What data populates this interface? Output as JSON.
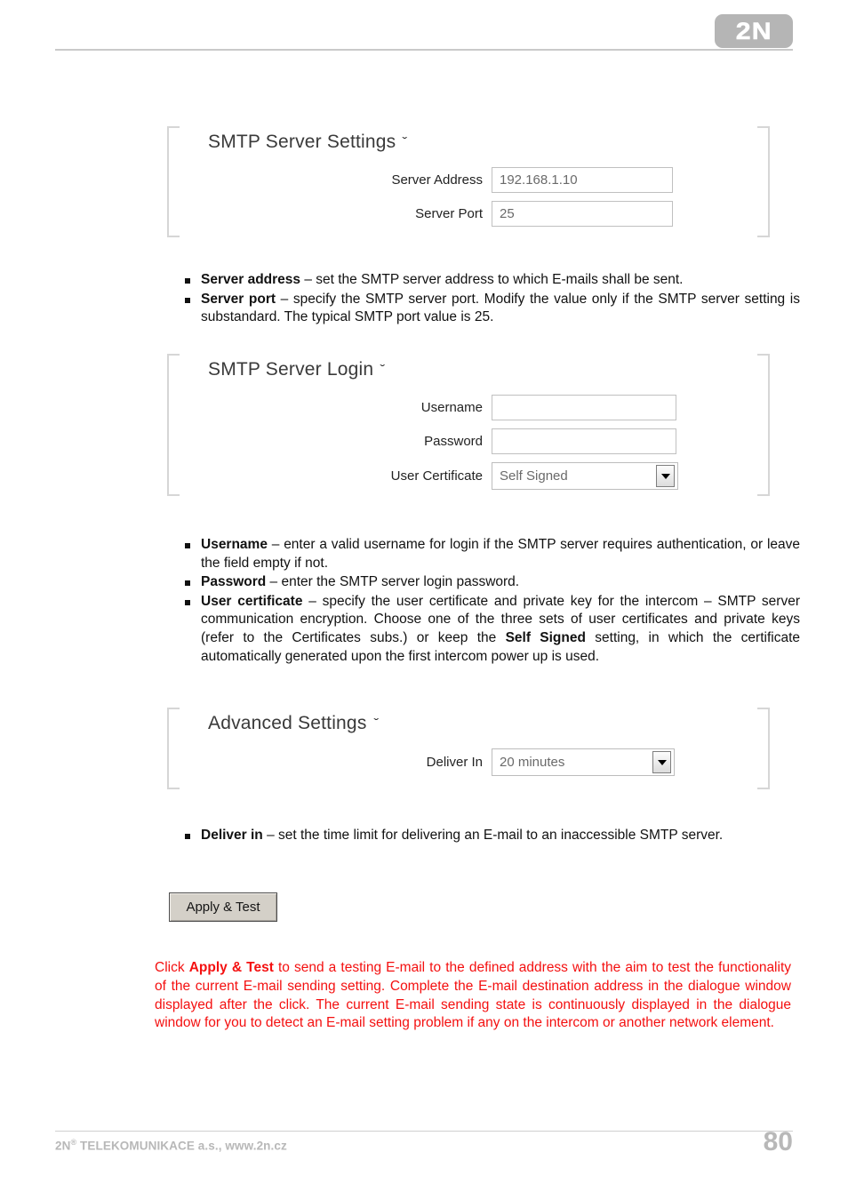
{
  "header": {
    "logo_text": "2N",
    "logo_name": "2n-logo"
  },
  "panels": {
    "smtp_server_settings": {
      "title": "SMTP Server Settings",
      "chevron": "ˇ",
      "fields": [
        {
          "label": "Server Address",
          "value": "192.168.1.10"
        },
        {
          "label": "Server Port",
          "value": "25"
        }
      ]
    },
    "smtp_server_login": {
      "title": "SMTP Server Login",
      "chevron": "ˇ",
      "fields": [
        {
          "label": "Username",
          "value": ""
        },
        {
          "label": "Password",
          "value": ""
        }
      ],
      "select": {
        "label": "User Certificate",
        "value": "Self Signed"
      }
    },
    "advanced_settings": {
      "title": "Advanced Settings",
      "chevron": "ˇ",
      "select": {
        "label": "Deliver In",
        "value": "20 minutes"
      }
    }
  },
  "bullets_group_1": {
    "items": [
      {
        "term": "Server address",
        "text": " – set the SMTP server address to which E-mails shall be sent."
      },
      {
        "term": "Server port",
        "text": " – specify the SMTP server port. Modify the value only if the SMTP server setting is substandard. The typical SMTP port value is 25."
      }
    ]
  },
  "bullets_group_2": {
    "items": [
      {
        "term": "Username",
        "text": " – enter a valid username for login if the SMTP server requires authentication, or leave the field empty if not."
      },
      {
        "term": "Password",
        "text": " – enter the SMTP server login password."
      },
      {
        "term": "User certificate",
        "text_part_1": " – specify the user certificate and private key for the intercom – SMTP server communication encryption. Choose one of the three sets of user certificates and private keys (refer to the Certificates subs.) or keep the ",
        "emphasis": "Self Signed",
        "text_part_2": " setting, in which the certificate automatically generated upon the first intercom power up is used."
      }
    ]
  },
  "bullets_group_3": {
    "items": [
      {
        "term": "Deliver in",
        "text": " – set the time limit for delivering an E-mail to an inaccessible SMTP server."
      }
    ]
  },
  "apply_button": {
    "label": "Apply & Test"
  },
  "note": {
    "color": "#f41010",
    "lead": "Click ",
    "emphasis": "Apply & Test",
    "body": " to send a testing E-mail to the defined address with the aim to test the functionality of the current E-mail sending setting. Complete the E-mail destination address in the dialogue window displayed after the click. The current E-mail sending state is continuously displayed in the dialogue window for you to detect an E-mail setting problem if any on the intercom or another network element."
  },
  "footer": {
    "company_prefix": "2N",
    "company_sup": "®",
    "company_rest": " TELEKOMUNIKACE a.s., www.2n.cz",
    "page_number": "80"
  }
}
